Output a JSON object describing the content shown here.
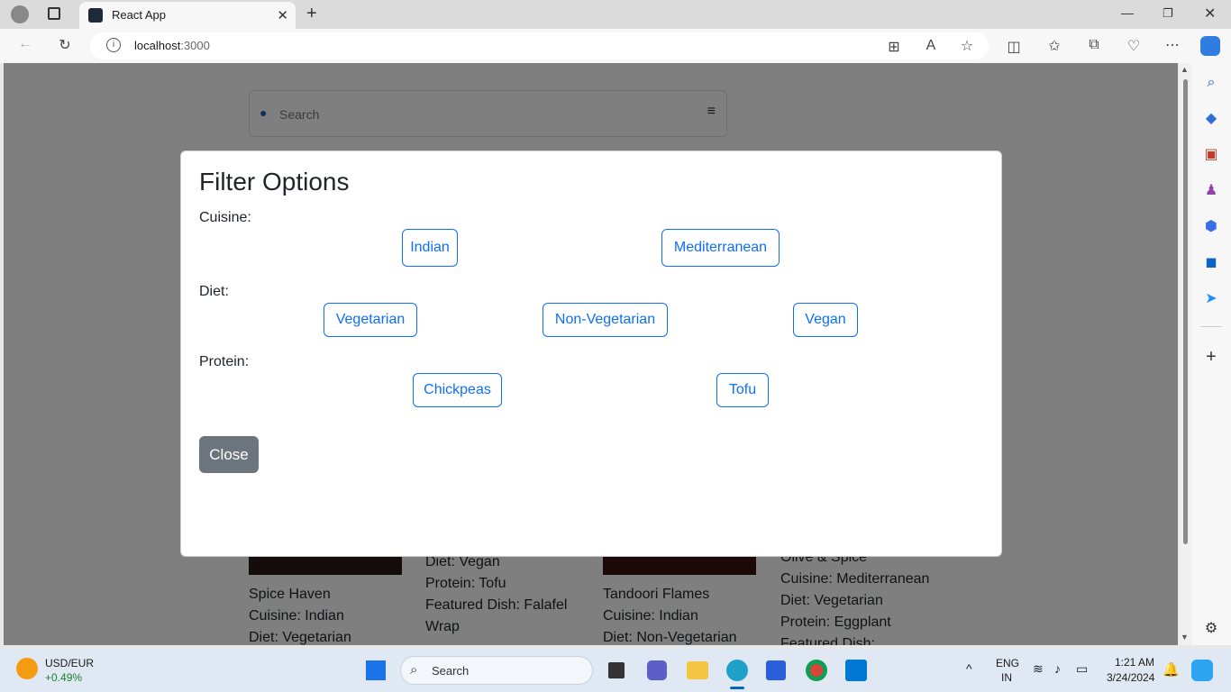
{
  "browser": {
    "tab_title": "React App",
    "url_host": "localhost",
    "url_port": ":3000"
  },
  "search": {
    "placeholder": "Search"
  },
  "modal": {
    "title": "Filter Options",
    "groups": {
      "cuisine": {
        "label": "Cuisine:",
        "options": [
          "Indian",
          "Mediterranean"
        ]
      },
      "diet": {
        "label": "Diet:",
        "options": [
          "Vegetarian",
          "Non-Vegetarian",
          "Vegan"
        ]
      },
      "protein": {
        "label": "Protein:",
        "options": [
          "Chickpeas",
          "Tofu"
        ]
      }
    },
    "close_label": "Close"
  },
  "cards": [
    {
      "lines": [
        "Spice Haven",
        "Cuisine: Indian",
        "Diet: Vegetarian"
      ]
    },
    {
      "lines": [
        "Diet: Vegan",
        "Protein: Tofu",
        "Featured Dish: Falafel",
        "Wrap"
      ]
    },
    {
      "lines": [
        "Tandoori Flames",
        "Cuisine: Indian",
        "Diet: Non-Vegetarian"
      ]
    },
    {
      "lines": [
        "Olive & Spice",
        "Cuisine: Mediterranean",
        "Diet: Vegetarian",
        "Protein: Eggplant",
        "Featured Dish:"
      ]
    }
  ],
  "taskbar": {
    "widget_label": "USD/EUR",
    "widget_value": "+0.49%",
    "search_label": "Search",
    "lang": "ENG",
    "region": "IN",
    "time": "1:21 AM",
    "date": "3/24/2024"
  },
  "colors": {
    "accent": "#0d6efd",
    "close_button": "#6c757d"
  }
}
